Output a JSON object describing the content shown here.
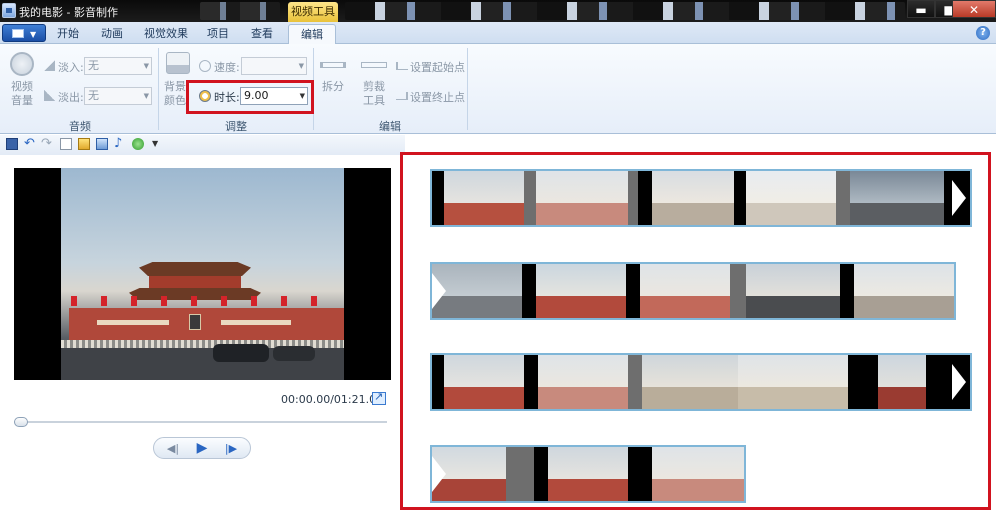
{
  "window": {
    "title": "我的电影 - 影音制作",
    "context_tab_header": "视频工具",
    "buttons": {
      "minimize": "▬",
      "maximize": "■",
      "close": "✕"
    }
  },
  "tabs": {
    "items": [
      {
        "label": "开始"
      },
      {
        "label": "动画"
      },
      {
        "label": "视觉效果"
      },
      {
        "label": "项目"
      },
      {
        "label": "查看"
      },
      {
        "label": "编辑",
        "active": true
      }
    ],
    "help": "?"
  },
  "ribbon": {
    "audio_group": {
      "label": "音频",
      "video_volume_label_line1": "视频",
      "video_volume_label_line2": "音量",
      "fade_in_label": "淡入:",
      "fade_in_value": "无",
      "fade_out_label": "淡出:",
      "fade_out_value": "无"
    },
    "adjust_group": {
      "label": "调整",
      "background_color_line1": "背景",
      "background_color_line2": "颜色",
      "speed_label": "速度:",
      "speed_value": "",
      "duration_label": "时长:",
      "duration_value": "9.00"
    },
    "edit_group": {
      "label": "编辑",
      "split_label": "拆分",
      "trim_line1": "剪裁",
      "trim_line2": "工具",
      "set_start_point": "设置起始点",
      "set_end_point": "设置终止点"
    }
  },
  "preview": {
    "time_display": "00:00.00/01:21.00",
    "transport": {
      "prev": "◀|",
      "play": "▶",
      "next": "|▶"
    }
  },
  "colors": {
    "highlight": "#d1131f",
    "clip_border": "#7fb6d8",
    "context_tab": "#f0cf5a"
  }
}
